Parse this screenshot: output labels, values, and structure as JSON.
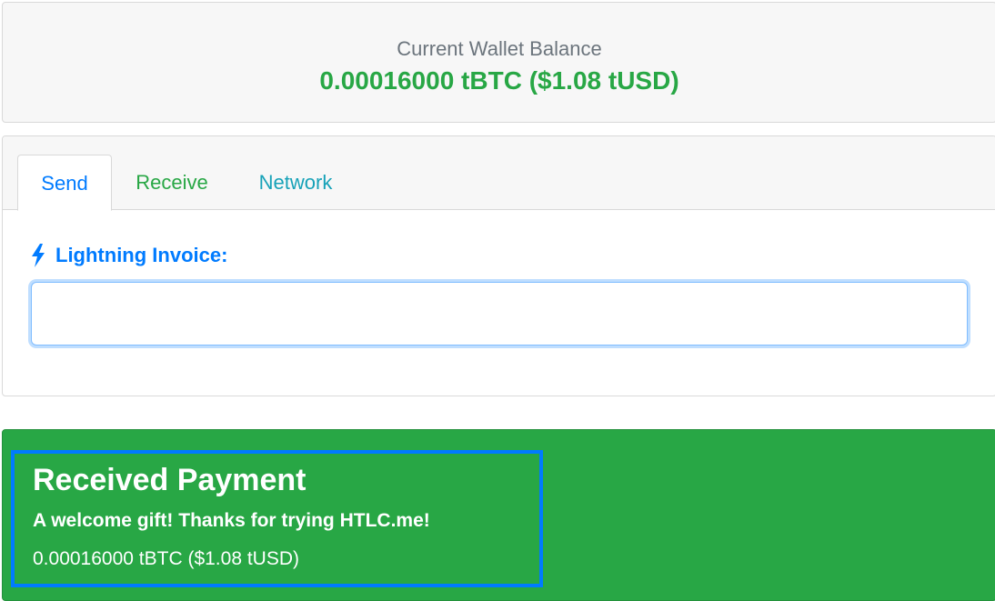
{
  "balance": {
    "label": "Current Wallet Balance",
    "value": "0.00016000 tBTC ($1.08 tUSD)"
  },
  "tabs": [
    {
      "label": "Send",
      "active": true
    },
    {
      "label": "Receive",
      "active": false
    },
    {
      "label": "Network",
      "active": false
    }
  ],
  "send": {
    "invoice_label": "Lightning Invoice:",
    "invoice_icon": "lightning-bolt-icon",
    "invoice_value": "",
    "invoice_placeholder": ""
  },
  "payment": {
    "title": "Received Payment",
    "message": "A welcome gift! Thanks for trying HTLC.me!",
    "amount": "0.00016000 tBTC ($1.08 tUSD)"
  },
  "colors": {
    "primary": "#007bff",
    "success": "#28a745",
    "info": "#17a2b8",
    "muted": "#6c757d"
  }
}
